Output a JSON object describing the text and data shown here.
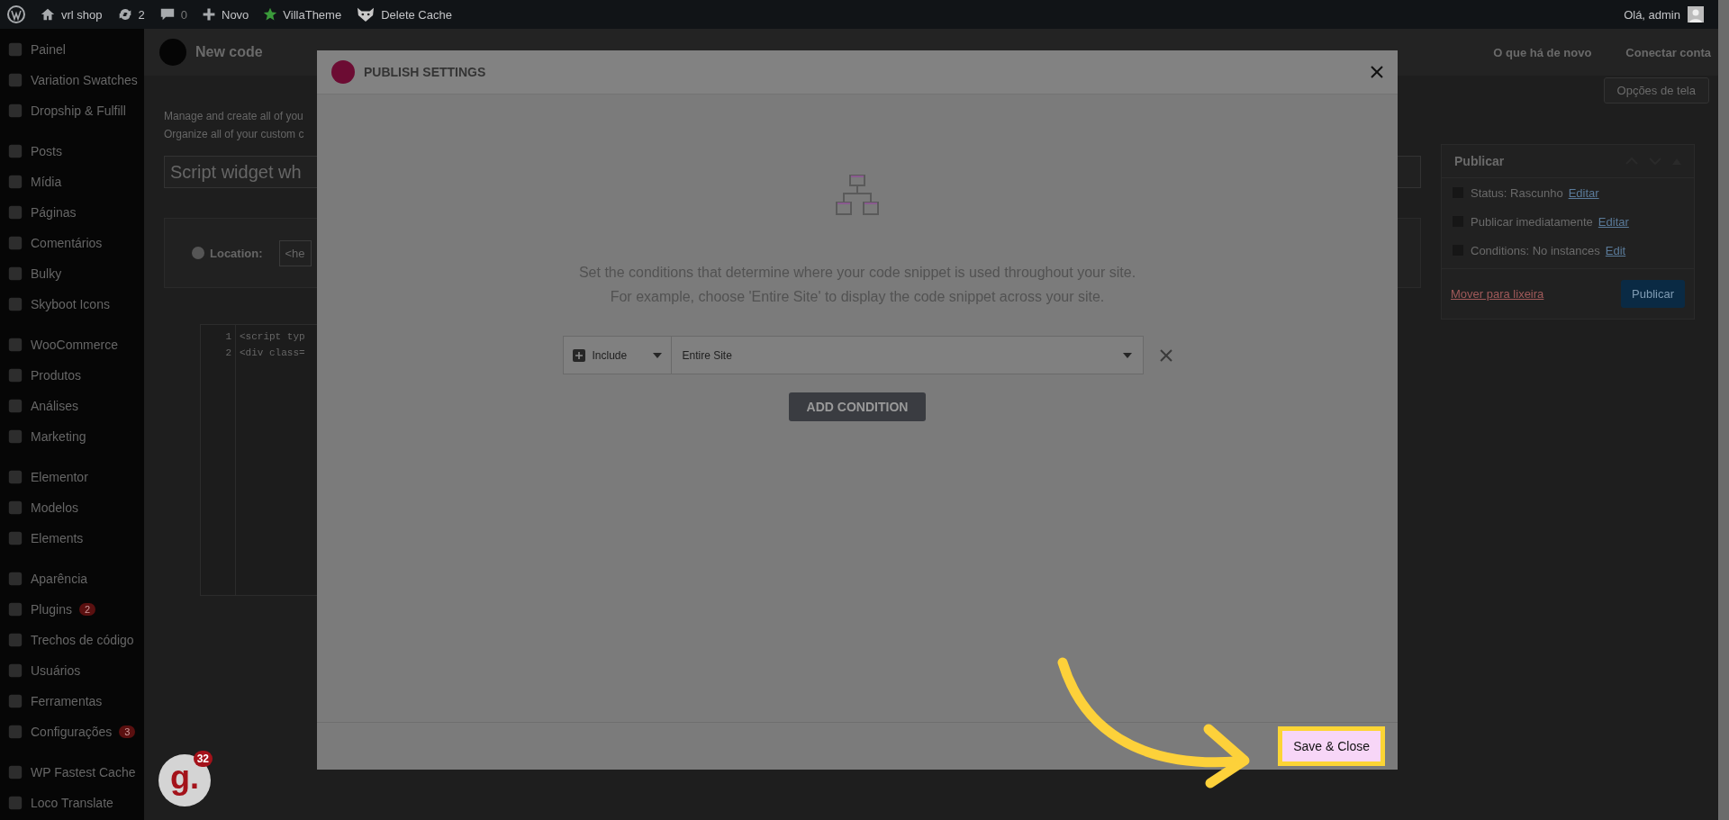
{
  "admin_bar": {
    "site": "vrl shop",
    "updates": "2",
    "comments": "0",
    "new": "Novo",
    "villatheme": "VillaTheme",
    "cache": "Delete Cache",
    "greeting": "Olá, admin"
  },
  "sidebar": {
    "groups": [
      [
        {
          "label": "Painel"
        },
        {
          "label": "Variation Swatches"
        },
        {
          "label": "Dropship & Fulfill"
        }
      ],
      [
        {
          "label": "Posts"
        },
        {
          "label": "Mídia"
        },
        {
          "label": "Páginas"
        },
        {
          "label": "Comentários"
        },
        {
          "label": "Bulky"
        },
        {
          "label": "Skyboot Icons"
        }
      ],
      [
        {
          "label": "WooCommerce"
        },
        {
          "label": "Produtos"
        },
        {
          "label": "Análises"
        },
        {
          "label": "Marketing"
        }
      ],
      [
        {
          "label": "Elementor"
        },
        {
          "label": "Modelos"
        },
        {
          "label": "Elements"
        }
      ],
      [
        {
          "label": "Aparência"
        },
        {
          "label": "Plugins",
          "count": "2"
        },
        {
          "label": "Trechos de código"
        },
        {
          "label": "Usuários"
        },
        {
          "label": "Ferramentas"
        },
        {
          "label": "Configurações",
          "count": "3"
        }
      ],
      [
        {
          "label": "WP Fastest Cache"
        },
        {
          "label": "Loco Translate"
        }
      ]
    ]
  },
  "header": {
    "title": "New code",
    "links": [
      "O que há de novo",
      "Conectar conta"
    ],
    "screen_options": "Opções de tela"
  },
  "content": {
    "description": [
      "Manage and create all of you",
      "Organize all of your custom c"
    ],
    "title_value": "Script widget wh",
    "location_label": "Location:",
    "location_value": "<he",
    "code_lines": [
      {
        "number": "1",
        "text": "<script typ"
      },
      {
        "number": "2",
        "text": "<div class="
      }
    ]
  },
  "publish_box": {
    "title": "Publicar",
    "rows": [
      {
        "text": "Status: Rascunho",
        "link": "Editar"
      },
      {
        "text": "Publicar imediatamente",
        "link": "Editar"
      },
      {
        "text": "Conditions: No instances",
        "link": "Edit"
      }
    ],
    "trash": "Mover para lixeira",
    "publish": "Publicar"
  },
  "modal": {
    "title": "PUBLISH SETTINGS",
    "description": [
      "Set the conditions that determine where your code snippet is used throughout your site.",
      "For example, choose 'Entire Site' to display the code snippet across your site."
    ],
    "conditions": [
      {
        "type": "Include",
        "target": "Entire Site"
      }
    ],
    "add_button": "ADD CONDITION",
    "save_button": "Save & Close"
  },
  "floating_badge": {
    "logo": "g.",
    "count": "32"
  }
}
